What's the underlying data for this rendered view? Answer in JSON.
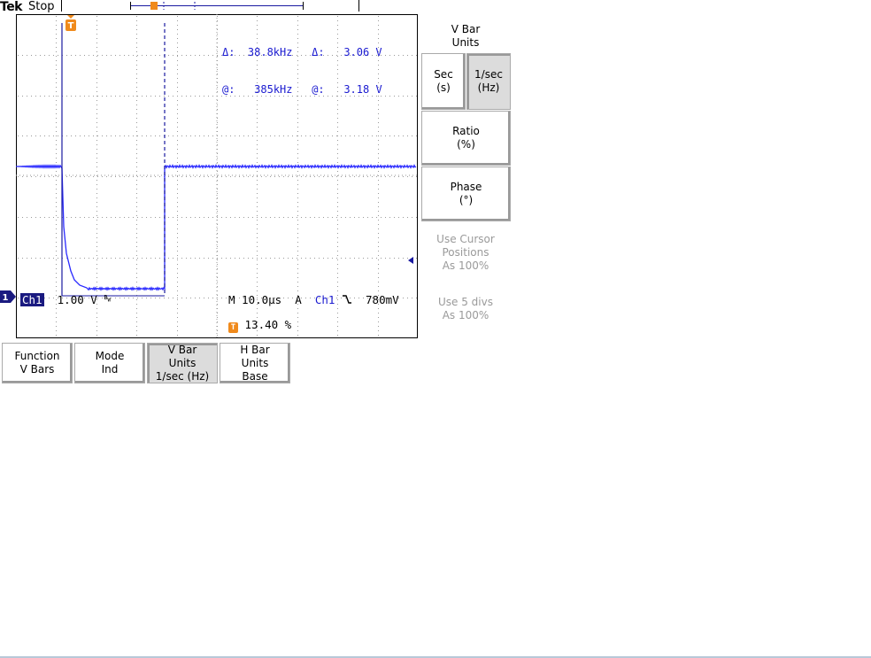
{
  "header": {
    "brand": "Tek",
    "run_state": "Stop"
  },
  "cursor_readout": {
    "delta_label": "Δ:",
    "at_label": "@:",
    "v_bar_delta": "38.8kHz",
    "v_bar_position": "385kHz",
    "h_bar_delta": "3.06 V",
    "h_bar_position": "3.18 V"
  },
  "channel": {
    "marker": "1",
    "name": "Ch1",
    "scale": "1.00 V",
    "bw_symbol": "B",
    "bw_sub": "W"
  },
  "timebase": {
    "text": "M 10.0µs  A  ",
    "trigger_source": "Ch1",
    "slope_symbol": "⌐",
    "trigger_level": "780mV"
  },
  "trigger_position": {
    "marker": "T",
    "value": "13.40 %"
  },
  "side_menu": {
    "title_line1": "V Bar",
    "title_line2": "Units",
    "buttons": [
      {
        "line1": "Sec",
        "line2": "(s)",
        "selected": false
      },
      {
        "line1": "1/sec",
        "line2": "(Hz)",
        "selected": true
      },
      {
        "line1": "Ratio",
        "line2": "(%)",
        "selected": false
      },
      {
        "line1": "Phase",
        "line2": "(°)",
        "selected": false
      }
    ],
    "note1": [
      "Use Cursor",
      "Positions",
      "As 100%"
    ],
    "note2": [
      "Use 5 divs",
      "As 100%"
    ]
  },
  "bottom_menu": [
    {
      "lines": [
        "Function",
        "V Bars"
      ],
      "selected": false
    },
    {
      "lines": [
        "Mode",
        "Ind"
      ],
      "selected": false
    },
    {
      "lines": [
        "V Bar",
        "Units",
        "1/sec (Hz)"
      ],
      "selected": true
    },
    {
      "lines": [
        "H Bar",
        "Units",
        "Base"
      ],
      "selected": false
    }
  ],
  "colors": {
    "trace": "#2a2aff",
    "cursor": "#1a1aa0",
    "trigger_marker": "#f08a1c",
    "readout_text": "#1a1ad0"
  }
}
